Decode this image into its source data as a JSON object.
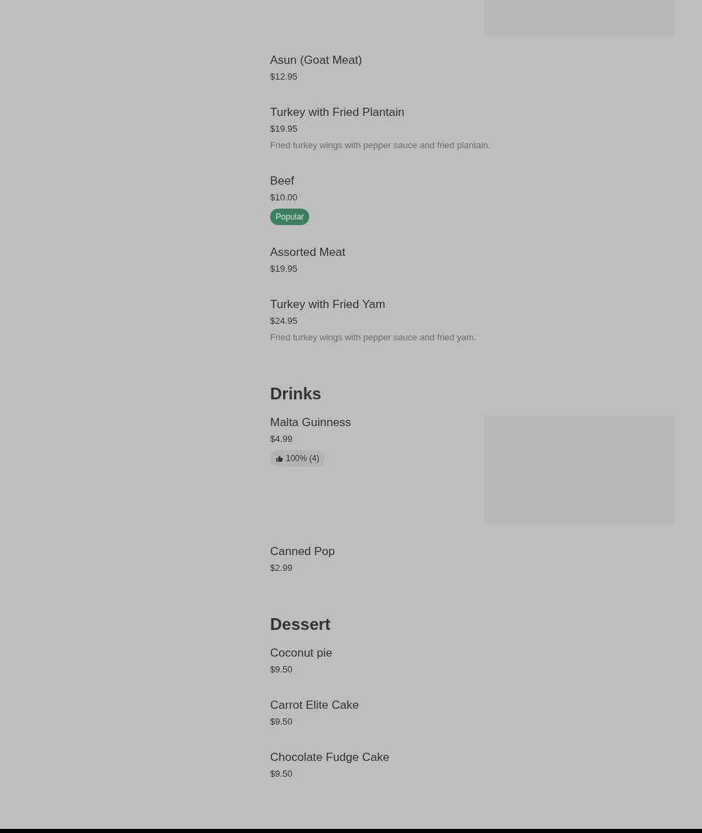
{
  "sections": [
    {
      "items": [
        {
          "kind": "image_only",
          "image": true
        },
        {
          "kind": "item",
          "name": "Asun (Goat Meat)",
          "price": "$12.95",
          "image": false
        },
        {
          "kind": "item",
          "name": "Turkey with Fried Plantain",
          "price": "$19.95",
          "description": "Fried turkey wings with pepper sauce and fried plantain.",
          "image": false
        },
        {
          "kind": "item",
          "name": "Beef",
          "price": "$10.00",
          "badge": {
            "kind": "popular",
            "text": "Popular"
          },
          "image": false
        },
        {
          "kind": "item",
          "name": "Assorted Meat",
          "price": "$19.95",
          "image": false
        },
        {
          "kind": "item",
          "name": "Turkey with Fried Yam",
          "price": "$24.95",
          "description": "Fried turkey wings with pepper sauce and fried yam.",
          "image": false
        }
      ]
    },
    {
      "title": "Drinks",
      "items": [
        {
          "kind": "item",
          "name": "Malta Guinness",
          "price": "$4.99",
          "badge": {
            "kind": "rating",
            "text": "100% (4)"
          },
          "image": true
        },
        {
          "kind": "item",
          "name": "Canned Pop",
          "price": "$2.99",
          "image": false
        }
      ]
    },
    {
      "title": "Dessert",
      "items": [
        {
          "kind": "item",
          "name": "Coconut pie",
          "price": "$9.50",
          "image": false
        },
        {
          "kind": "item",
          "name": "Carrot Elite Cake",
          "price": "$9.50",
          "image": false
        },
        {
          "kind": "item",
          "name": "Chocolate Fudge Cake",
          "price": "$9.50",
          "image": false
        }
      ]
    }
  ]
}
